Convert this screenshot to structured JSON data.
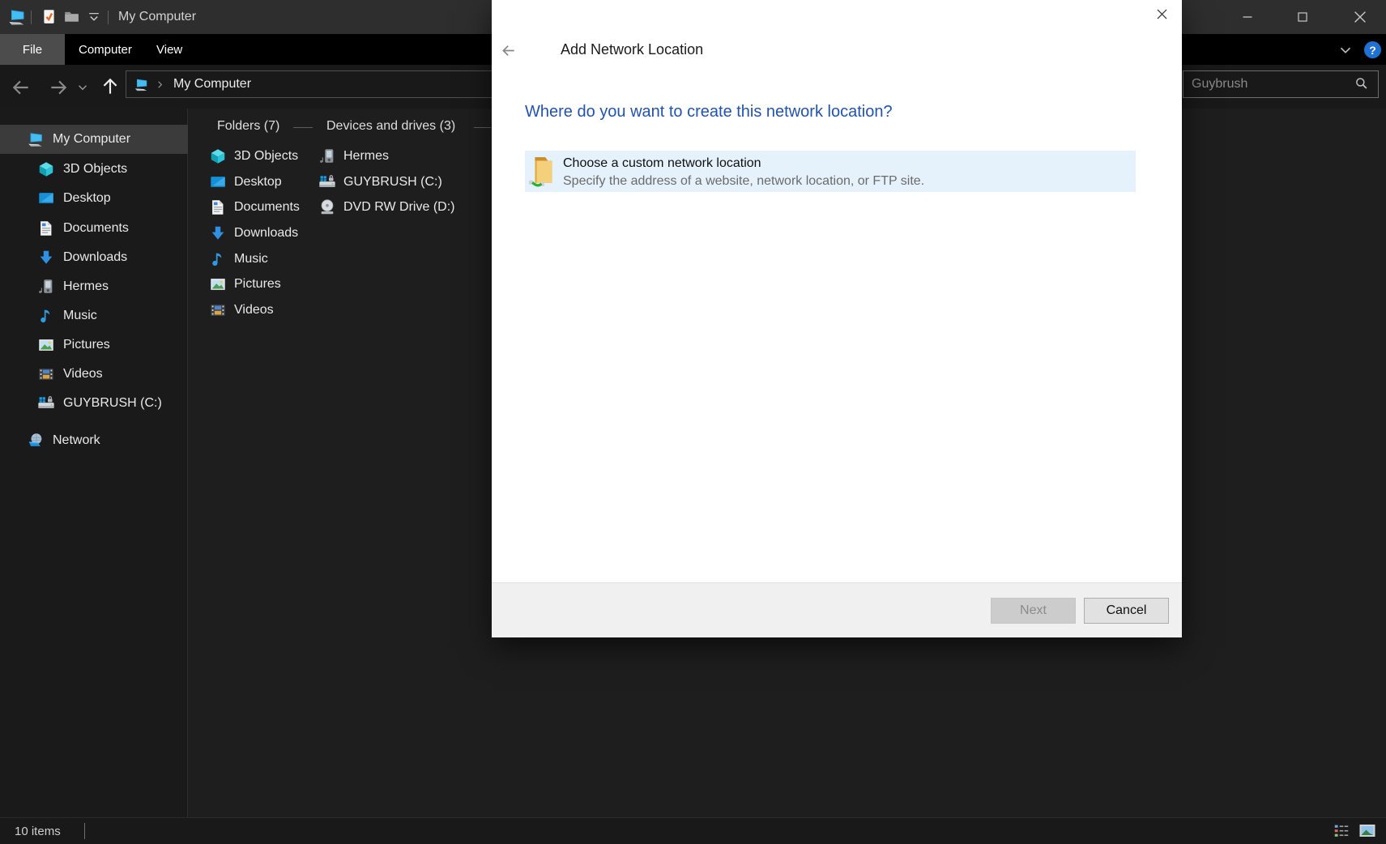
{
  "window": {
    "title": "My Computer"
  },
  "menu": {
    "items": [
      "File",
      "Computer",
      "View"
    ]
  },
  "navbar": {
    "address": "My Computer",
    "search_value": "Guybrush"
  },
  "sidebar": {
    "items": [
      {
        "label": "My Computer"
      },
      {
        "label": "3D Objects"
      },
      {
        "label": "Desktop"
      },
      {
        "label": "Documents"
      },
      {
        "label": "Downloads"
      },
      {
        "label": "Hermes"
      },
      {
        "label": "Music"
      },
      {
        "label": "Pictures"
      },
      {
        "label": "Videos"
      },
      {
        "label": "GUYBRUSH (C:)"
      },
      {
        "label": "Network"
      }
    ]
  },
  "content": {
    "groups": [
      {
        "label": "Folders (7)",
        "items": [
          "3D Objects",
          "Desktop",
          "Documents",
          "Downloads",
          "Music",
          "Pictures",
          "Videos"
        ]
      },
      {
        "label": "Devices and drives (3)",
        "items": [
          "Hermes",
          "GUYBRUSH (C:)",
          "DVD RW Drive (D:)"
        ]
      }
    ]
  },
  "statusbar": {
    "items_count": "10 items"
  },
  "dialog": {
    "title": "Add Network Location",
    "heading": "Where do you want to create this network location?",
    "option_title": "Choose a custom network location",
    "option_subtitle": "Specify the address of a website, network location, or FTP site.",
    "next_label": "Next",
    "cancel_label": "Cancel"
  },
  "colors": {
    "heading_blue": "#2053b3",
    "selection_blue": "#e6f2fb",
    "accent_blue": "#2f8fe0",
    "sidebar_selected": "#3b3b3b"
  }
}
